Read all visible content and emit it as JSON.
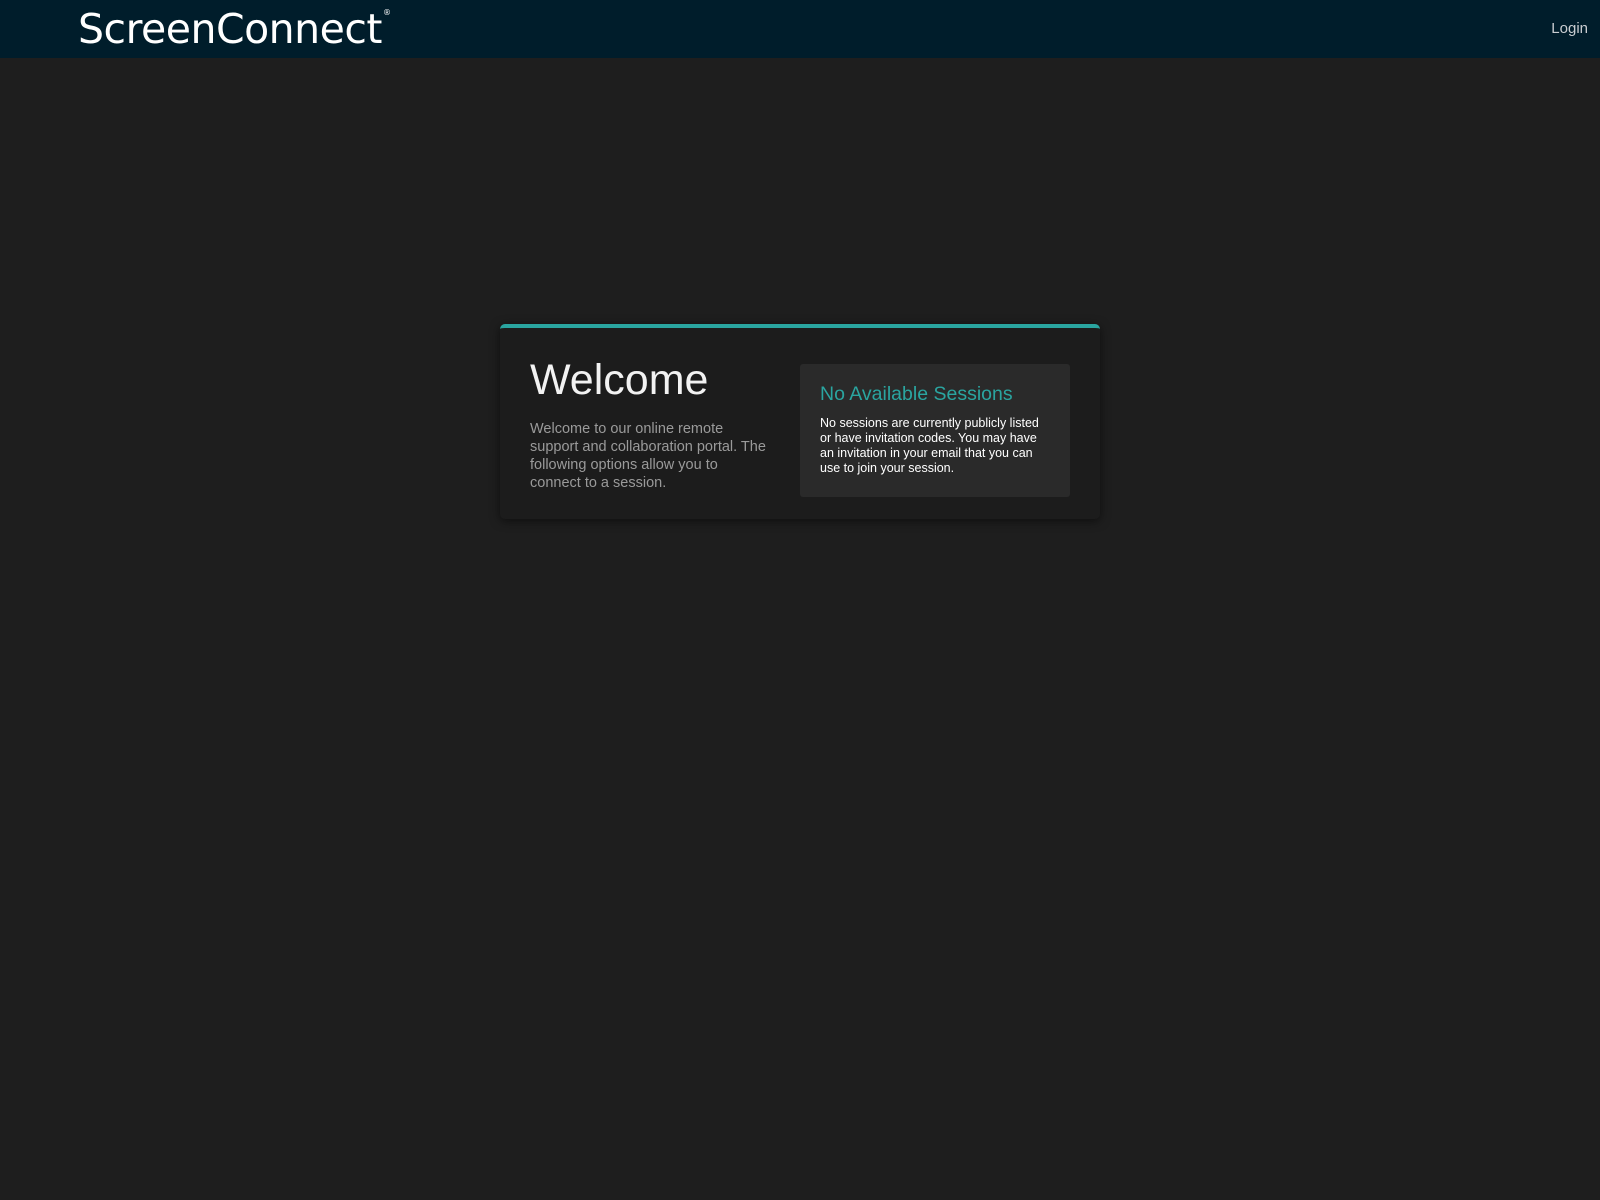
{
  "header": {
    "logo_text": "ScreenConnect",
    "logo_mark": "®",
    "login_label": "Login"
  },
  "welcome": {
    "title": "Welcome",
    "description": "Welcome to our online remote support and collaboration portal. The following options allow you to connect to a session."
  },
  "sessions": {
    "title": "No Available Sessions",
    "message": "No sessions are currently publicly listed or have invitation codes. You may have an invitation in your email that you can use to join your session."
  },
  "colors": {
    "header_bg": "#001d2b",
    "page_bg": "#1e1e1e",
    "accent": "#2aa5a0"
  }
}
